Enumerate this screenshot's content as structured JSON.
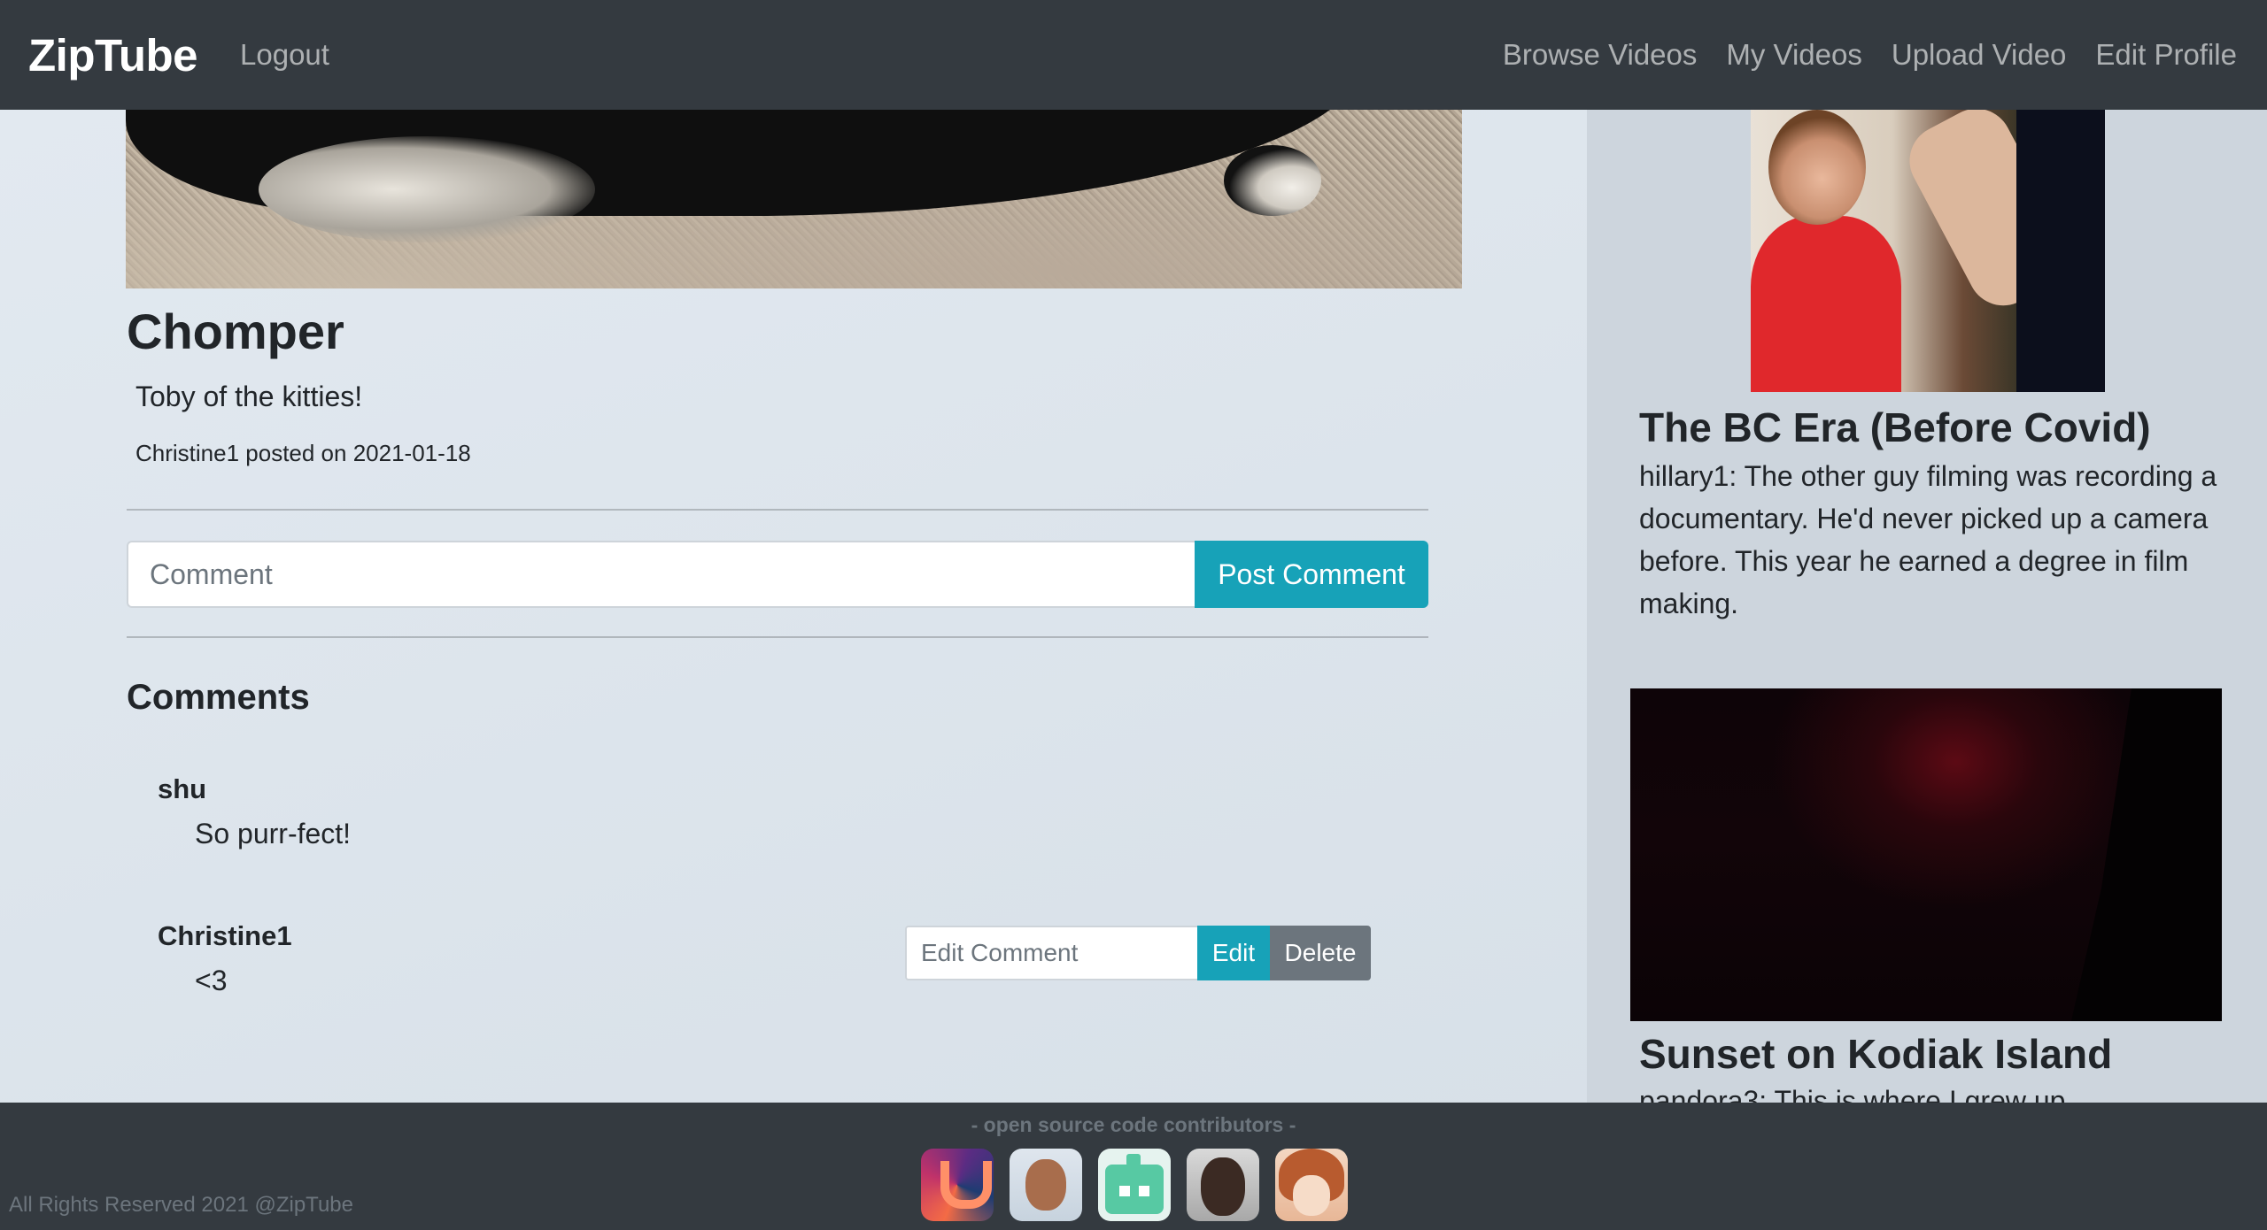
{
  "navbar": {
    "brand": "ZipTube",
    "logout": "Logout",
    "links": [
      "Browse Videos",
      "My Videos",
      "Upload Video",
      "Edit Profile"
    ]
  },
  "video": {
    "title": "Chomper",
    "description": "Toby of the kitties!",
    "meta": "Christine1 posted on 2021-01-18"
  },
  "comment_form": {
    "placeholder": "Comment",
    "button": "Post Comment"
  },
  "comments": {
    "heading": "Comments",
    "items": [
      {
        "author": "shu",
        "text": "So purr-fect!"
      },
      {
        "author": "Christine1",
        "text": "<3"
      }
    ],
    "edit_placeholder": "Edit Comment",
    "edit_button": "Edit",
    "delete_button": "Delete"
  },
  "sidebar": {
    "videos": [
      {
        "title": "The BC Era (Before Covid)",
        "description": "hillary1: The other guy filming was recording a documentary. He'd never picked up a camera before. This year he earned a degree in film making."
      },
      {
        "title": "Sunset on Kodiak Island",
        "description": "pandora3: This is where I grew up."
      }
    ]
  },
  "footer": {
    "contributors_label": "-  open source code contributors  -",
    "rights": "All Rights Reserved 2021 @ZipTube"
  },
  "colors": {
    "navbar": "#343a40",
    "info": "#17a2b8",
    "secondary": "#6c757d"
  }
}
